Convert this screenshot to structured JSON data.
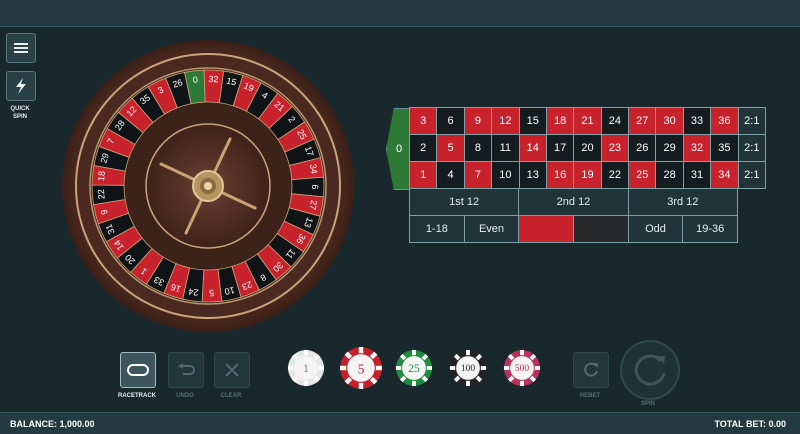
{
  "controls": {
    "quick_spin_label": "QUICK\nSPIN",
    "racetrack_label": "RACETRACK",
    "undo_label": "UNDO",
    "clear_label": "CLEAR",
    "rebet_label": "REBET",
    "spin_label": "SPIN"
  },
  "wheel": {
    "sequence": [
      "0",
      "32",
      "15",
      "19",
      "4",
      "21",
      "2",
      "25",
      "17",
      "34",
      "6",
      "27",
      "13",
      "36",
      "11",
      "30",
      "8",
      "23",
      "10",
      "5",
      "24",
      "16",
      "33",
      "1",
      "20",
      "14",
      "31",
      "9",
      "22",
      "18",
      "29",
      "7",
      "28",
      "12",
      "35",
      "3",
      "26"
    ]
  },
  "table": {
    "zero": "0",
    "rows": [
      [
        {
          "n": "3",
          "c": "red"
        },
        {
          "n": "6",
          "c": "black"
        },
        {
          "n": "9",
          "c": "red"
        },
        {
          "n": "12",
          "c": "red"
        },
        {
          "n": "15",
          "c": "black"
        },
        {
          "n": "18",
          "c": "red"
        },
        {
          "n": "21",
          "c": "red"
        },
        {
          "n": "24",
          "c": "black"
        },
        {
          "n": "27",
          "c": "red"
        },
        {
          "n": "30",
          "c": "red"
        },
        {
          "n": "33",
          "c": "black"
        },
        {
          "n": "36",
          "c": "red"
        },
        {
          "n": "2:1",
          "c": "col"
        }
      ],
      [
        {
          "n": "2",
          "c": "black"
        },
        {
          "n": "5",
          "c": "red"
        },
        {
          "n": "8",
          "c": "black"
        },
        {
          "n": "11",
          "c": "black"
        },
        {
          "n": "14",
          "c": "red"
        },
        {
          "n": "17",
          "c": "black"
        },
        {
          "n": "20",
          "c": "black"
        },
        {
          "n": "23",
          "c": "red"
        },
        {
          "n": "26",
          "c": "black"
        },
        {
          "n": "29",
          "c": "black"
        },
        {
          "n": "32",
          "c": "red"
        },
        {
          "n": "35",
          "c": "black"
        },
        {
          "n": "2:1",
          "c": "col"
        }
      ],
      [
        {
          "n": "1",
          "c": "red"
        },
        {
          "n": "4",
          "c": "black"
        },
        {
          "n": "7",
          "c": "red"
        },
        {
          "n": "10",
          "c": "black"
        },
        {
          "n": "13",
          "c": "black"
        },
        {
          "n": "16",
          "c": "red"
        },
        {
          "n": "19",
          "c": "red"
        },
        {
          "n": "22",
          "c": "black"
        },
        {
          "n": "25",
          "c": "red"
        },
        {
          "n": "28",
          "c": "black"
        },
        {
          "n": "31",
          "c": "black"
        },
        {
          "n": "34",
          "c": "red"
        },
        {
          "n": "2:1",
          "c": "col"
        }
      ]
    ],
    "dozens": [
      "1st 12",
      "2nd 12",
      "3rd 12"
    ],
    "outside": {
      "low": "1-18",
      "even": "Even",
      "red": "",
      "black": "",
      "odd": "Odd",
      "high": "19-36"
    }
  },
  "chips": [
    {
      "value": "1",
      "color": "#e6e6e6",
      "text": "#777777"
    },
    {
      "value": "5",
      "color": "#c4212c",
      "text": "#c4212c"
    },
    {
      "value": "25",
      "color": "#1f8d3d",
      "text": "#1f8d3d"
    },
    {
      "value": "100",
      "color": "#232323",
      "text": "#232323"
    },
    {
      "value": "500",
      "color": "#b8325e",
      "text": "#b8325e"
    }
  ],
  "footer": {
    "balance": "BALANCE: 1,000.00",
    "total_bet": "TOTAL BET: 0.00"
  },
  "colors": {
    "red": "#c8232c",
    "black": "#141c1f",
    "green": "#2d7a36"
  }
}
